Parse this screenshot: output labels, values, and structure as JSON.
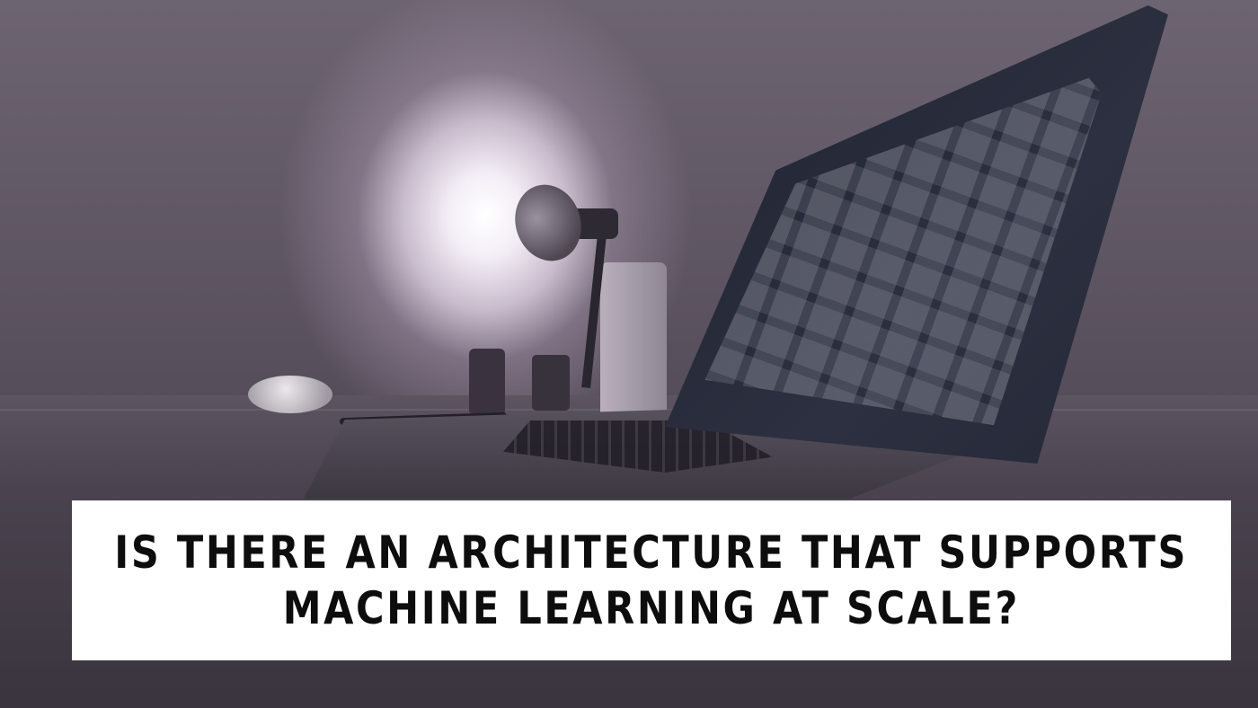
{
  "caption": {
    "line1": "IS THERE AN ARCHITECTURE THAT SUPPORTS",
    "line2": "MACHINE LEARNING AT SCALE?"
  }
}
